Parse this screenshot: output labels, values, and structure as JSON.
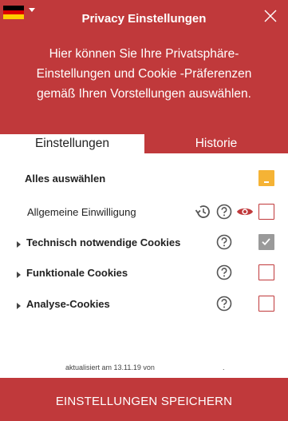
{
  "header": {
    "title": "Privacy Einstellungen",
    "intro_lines": [
      "Hier können Sie Ihre Privatsphäre-",
      "Einstellungen und Cookie -Präferenzen",
      "gemäß Ihren Vorstellungen auswählen."
    ],
    "flag": "german-flag-icon",
    "close_icon": "close-icon"
  },
  "tabs": [
    {
      "label": "Einstellungen",
      "active": true
    },
    {
      "label": "Historie",
      "active": false
    }
  ],
  "options": [
    {
      "label": "Alles auswählen",
      "state": "partial"
    },
    {
      "label": "Allgemeine Einwilligung",
      "state": "unchecked",
      "icons": [
        "history-icon",
        "help-icon",
        "eye-icon"
      ]
    },
    {
      "label": "Technisch notwendige Cookies",
      "state": "checked",
      "icons": [
        "help-icon"
      ]
    },
    {
      "label": "Funktionale Cookies",
      "state": "unchecked",
      "icons": [
        "help-icon"
      ]
    },
    {
      "label": "Analyse-Cookies",
      "state": "unchecked",
      "icons": [
        "help-icon"
      ]
    }
  ],
  "footer": {
    "updated_text": "aktualisiert am 13.11.19 von",
    "trailing_text": ".",
    "save_label": "EINSTELLUNGEN SPEICHERN"
  },
  "colors": {
    "brand": "#c0393b",
    "checked": "#9a9a9a",
    "partial": "#f5b335"
  }
}
